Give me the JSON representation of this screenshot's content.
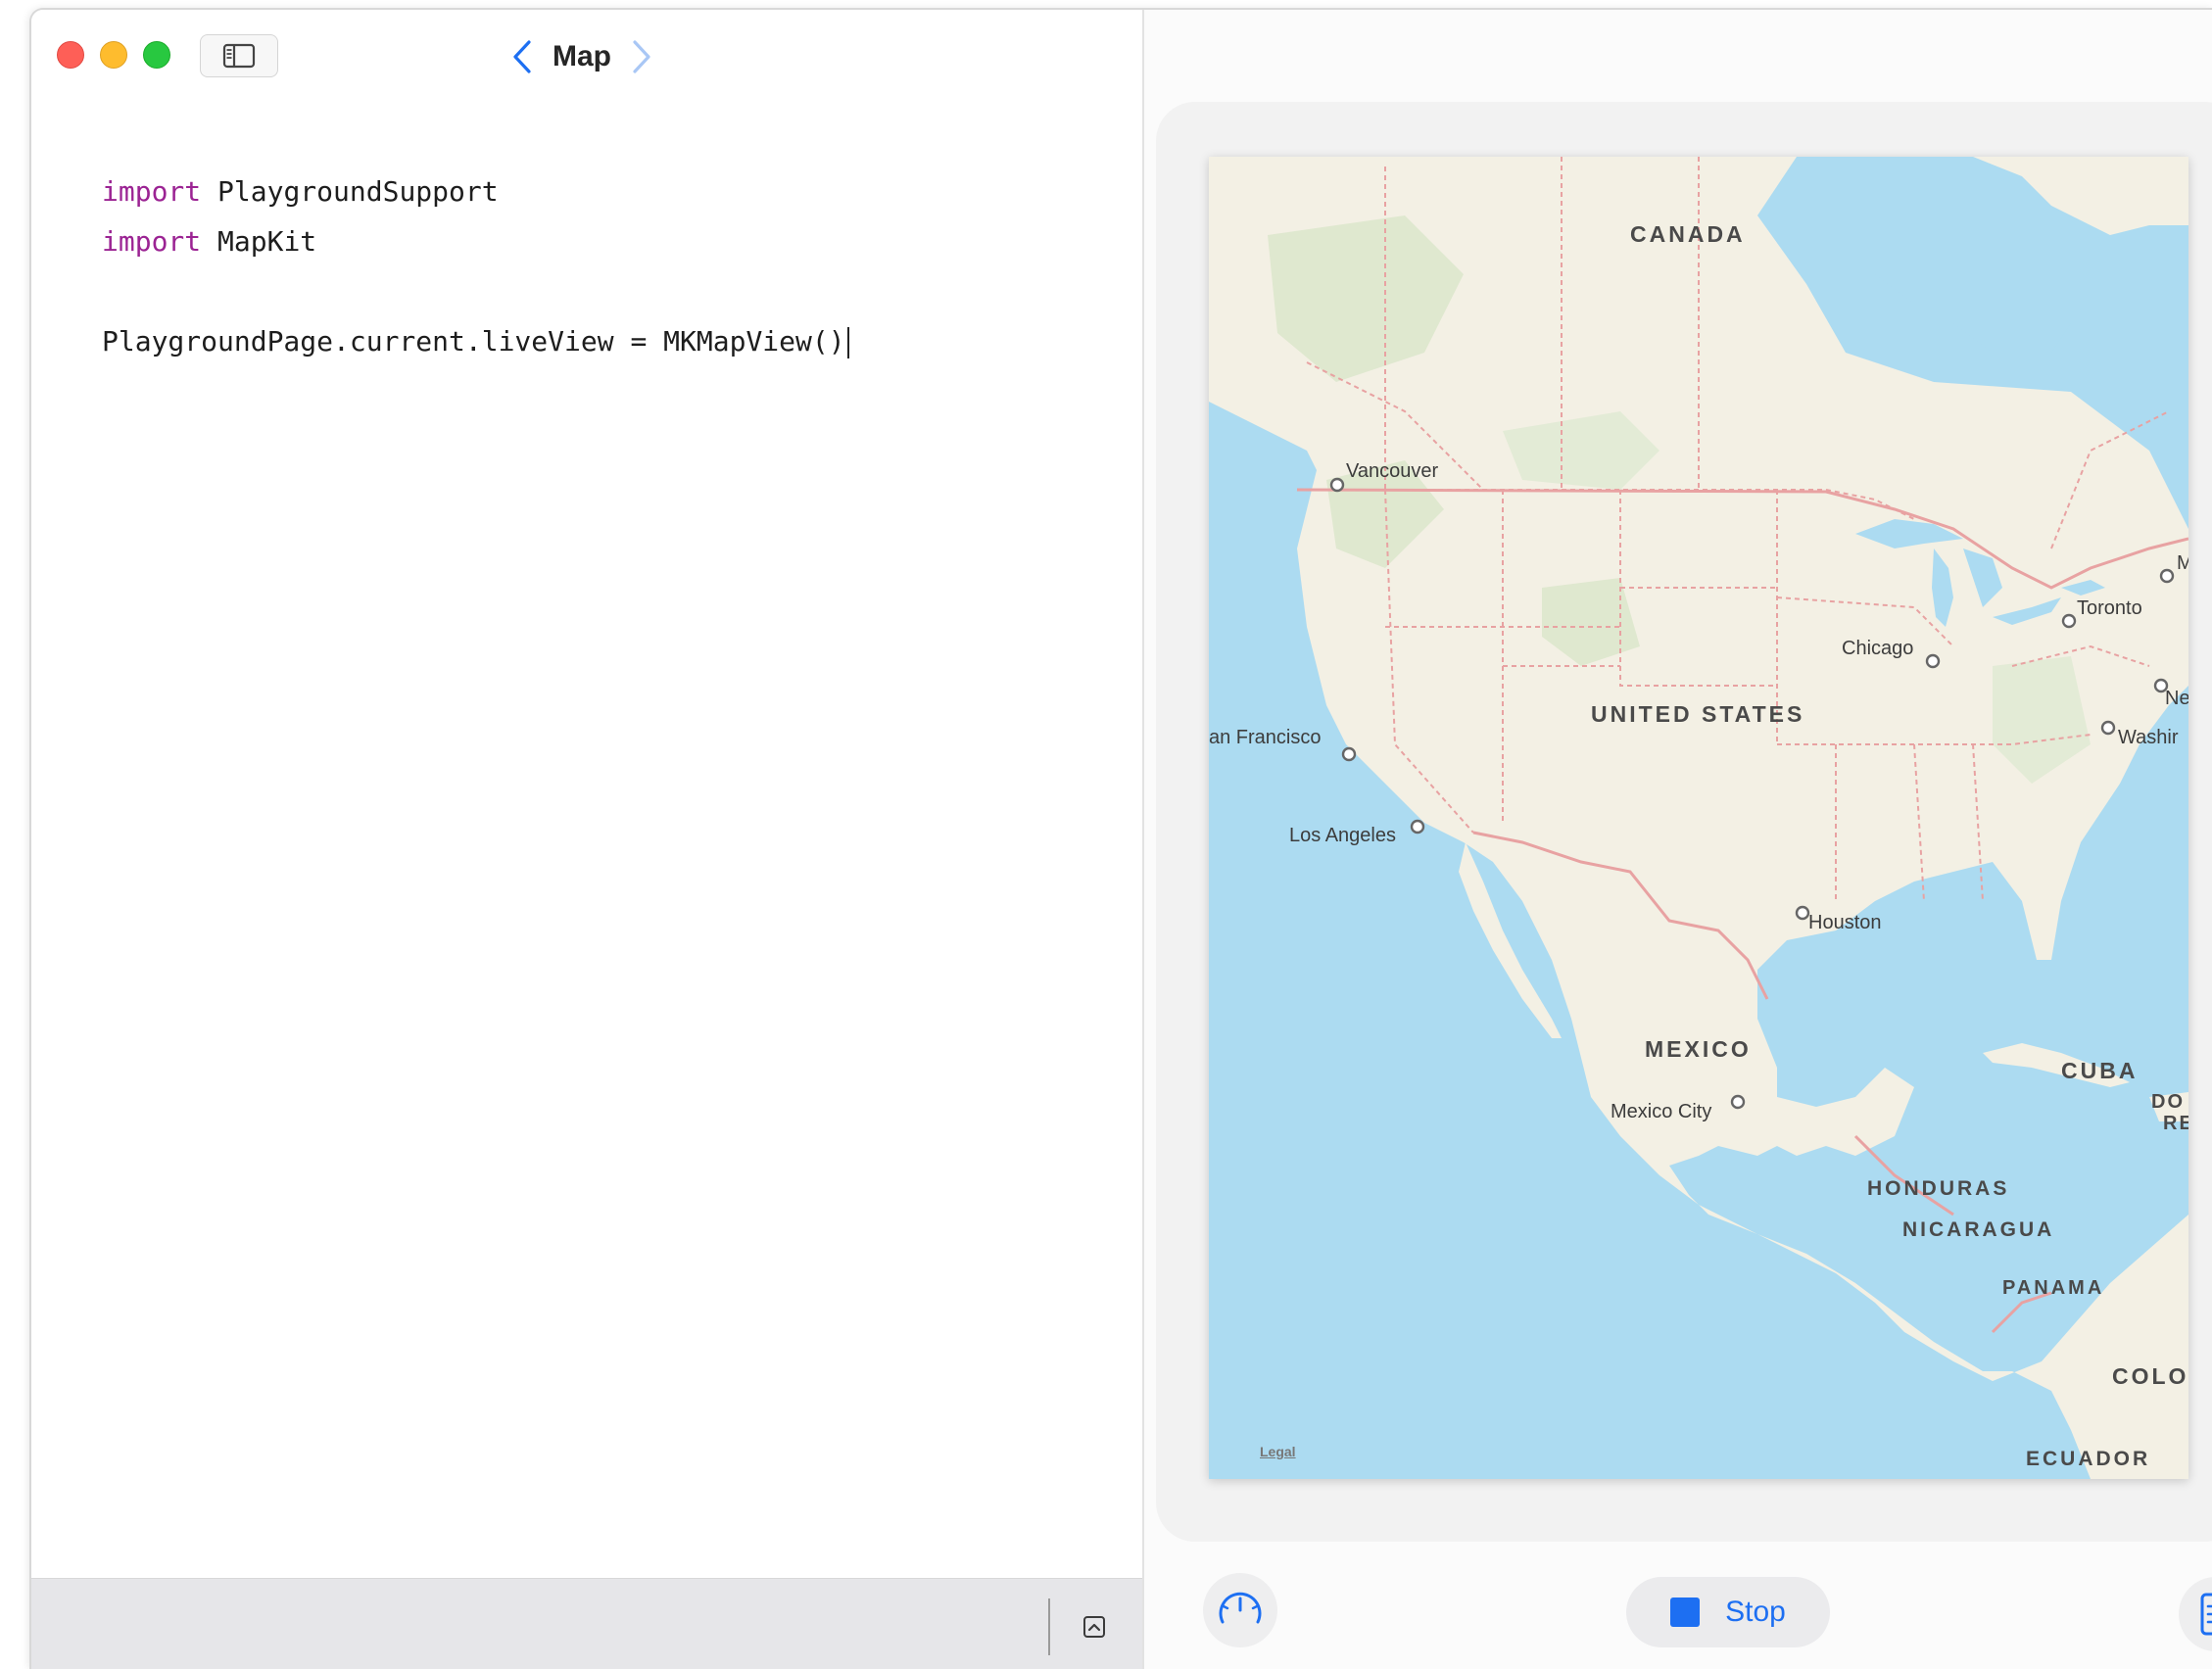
{
  "window": {
    "title": "Map",
    "nav_back_icon": "chevron-left-icon",
    "nav_forward_icon": "chevron-right-icon",
    "sidebar_toggle_icon": "sidebar-icon"
  },
  "editor": {
    "lines": [
      {
        "keyword": "import",
        "rest": " PlaygroundSupport"
      },
      {
        "keyword": "import",
        "rest": " MapKit"
      },
      {
        "keyword": "",
        "rest": ""
      },
      {
        "keyword": "",
        "rest": "PlaygroundPage.current.liveView = MKMapView()"
      }
    ],
    "keyword_color": "#9b2393",
    "bottom_expand_icon": "chevron-up-square-icon"
  },
  "toolbar": {
    "add_icon": "plus-icon",
    "share_icon": "share-icon"
  },
  "map": {
    "countries": {
      "canada": "CANADA",
      "united_states": "UNITED STATES",
      "mexico": "MEXICO",
      "cuba": "CUBA",
      "honduras": "HONDURAS",
      "nicaragua": "NICARAGUA",
      "panama": "PANAMA",
      "colombia": "COLOI",
      "ecuador": "ECUADOR",
      "dominican_republic_line1": "DO",
      "dominican_republic_line2": "RE"
    },
    "cities": {
      "vancouver": "Vancouver",
      "san_francisco": "an Francisco",
      "los_angeles": "Los Angeles",
      "houston": "Houston",
      "chicago": "Chicago",
      "toronto": "Toronto",
      "washington": "Washir",
      "new_york": "Ne",
      "montreal": "M",
      "mexico_city": "Mexico City"
    },
    "legal": "Legal",
    "water_color": "#acdbf1",
    "land_color": "#f3f0e4",
    "border_color": "#e8a2a2"
  },
  "controls": {
    "stop_label": "Stop",
    "stop_color": "#1d6ff2",
    "speed_icon": "speedometer-icon",
    "doc_icon": "document-icon"
  }
}
